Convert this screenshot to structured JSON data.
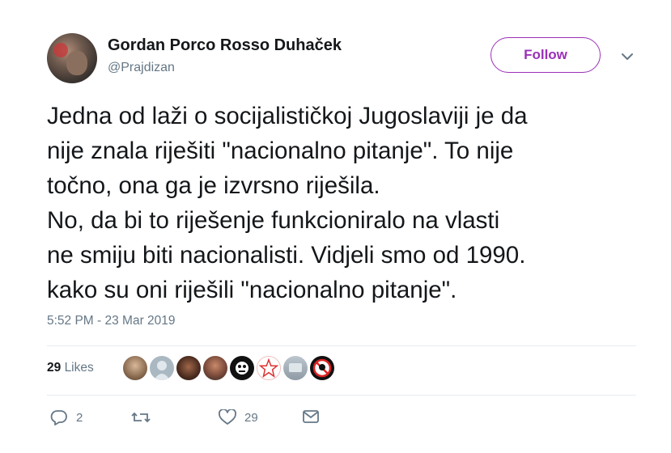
{
  "author": {
    "name": "Gordan Porco Rosso Duhaček",
    "handle": "@Prajdizan",
    "avatar_icon": "profile-avatar"
  },
  "follow_button": {
    "label": "Follow",
    "color": "#9b30b8"
  },
  "menu_icon": "chevron-down-icon",
  "tweet": {
    "text": "Jedna od laži o socijalističkoj Jugoslaviji je da\nnije znala riješiti \"nacionalno pitanje\". To nije\ntočno, ona ga je izvrsno riješila.\nNo, da bi to riješenje funkcioniralo na vlasti\nne smiju biti nacionalisti. Vidjeli smo od 1990.\nkako su oni riješili \"nacionalno pitanje\".",
    "timestamp": "5:52 PM - 23 Mar 2019"
  },
  "likes": {
    "count": "29",
    "label": "Likes",
    "avatars": [
      "liker-avatar-1",
      "liker-avatar-2",
      "liker-avatar-3",
      "liker-avatar-4",
      "liker-avatar-5",
      "liker-avatar-6",
      "liker-avatar-7",
      "liker-avatar-8"
    ]
  },
  "actions": {
    "reply_count": "2",
    "retweet_count": "",
    "like_count": "29",
    "icons": [
      "reply-icon",
      "retweet-icon",
      "like-icon",
      "message-icon"
    ]
  },
  "colors": {
    "text": "#14171a",
    "muted": "#657786",
    "divider": "#e6ecf0",
    "accent": "#9b30b8"
  }
}
